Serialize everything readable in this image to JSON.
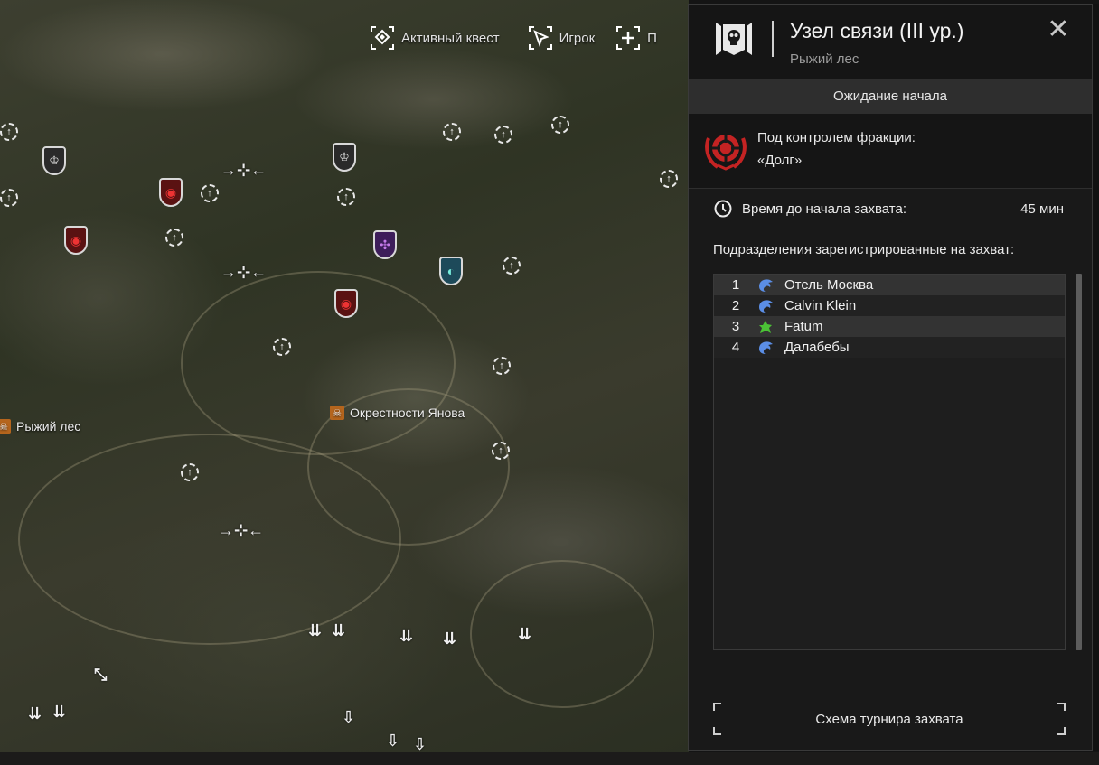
{
  "top_bar": {
    "items": [
      {
        "label": "Активный квест",
        "icon": "quest-diamond-icon"
      },
      {
        "label": "Игрок",
        "icon": "cursor-arrow-icon"
      },
      {
        "label": "П",
        "icon": "plus-crosshair-icon"
      }
    ]
  },
  "map": {
    "labels": [
      {
        "text": "Рыжий лес",
        "icon": "skull-location-icon"
      },
      {
        "text": "Окрестности Янова",
        "icon": "skull-location-icon"
      }
    ]
  },
  "panel": {
    "title": "Узел связи (III ур.)",
    "subtitle": "Рыжий лес",
    "status": "Ожидание начала",
    "faction": {
      "line1": "Под контролем фракции:",
      "line2": "«Долг»",
      "color": "#d42b2b"
    },
    "timer": {
      "label": "Время до начала захвата:",
      "value": "45 мин"
    },
    "registered_title": "Подразделения зарегистрированные на захват:",
    "units": [
      {
        "num": "1",
        "name": "Отель Москва",
        "icon": "blue-eagle-icon",
        "color": "#5b8ee6"
      },
      {
        "num": "2",
        "name": "Calvin Klein",
        "icon": "blue-eagle-icon",
        "color": "#5b8ee6"
      },
      {
        "num": "3",
        "name": "Fatum",
        "icon": "green-wolf-icon",
        "color": "#4bc236"
      },
      {
        "num": "4",
        "name": "Далабебы",
        "icon": "blue-eagle-icon",
        "color": "#5b8ee6"
      }
    ],
    "bracket_button": "Схема турнира захвата"
  }
}
